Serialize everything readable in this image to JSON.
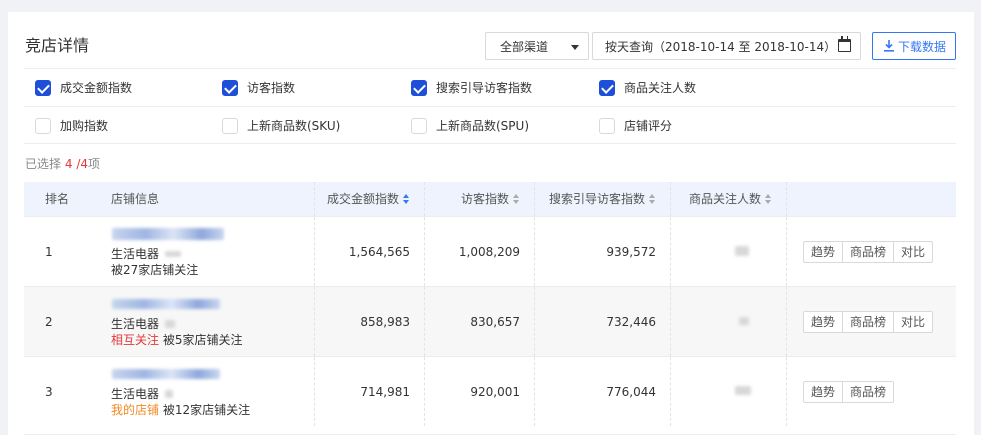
{
  "title": "竞店详情",
  "channel_select": {
    "value": "全部渠道"
  },
  "date_query": {
    "label": "按天查询（2018-10-14 至 2018-10-14）"
  },
  "download_button": {
    "label": "下载数据"
  },
  "metrics": [
    {
      "label": "成交金额指数",
      "checked": true
    },
    {
      "label": "访客指数",
      "checked": true
    },
    {
      "label": "搜索引导访客指数",
      "checked": true
    },
    {
      "label": "商品关注人数",
      "checked": true
    },
    {
      "label": "加购指数",
      "checked": false
    },
    {
      "label": "上新商品数(SKU)",
      "checked": false
    },
    {
      "label": "上新商品数(SPU)",
      "checked": false
    },
    {
      "label": "店铺评分",
      "checked": false
    }
  ],
  "selection": {
    "prefix": "已选择",
    "count": "4",
    "total": "/4",
    "suffix": "项"
  },
  "table": {
    "headers": {
      "rank": "排名",
      "shop": "店铺信息",
      "gmv": "成交金额指数",
      "visitors": "访客指数",
      "search_visitors": "搜索引导访客指数",
      "followers": "商品关注人数"
    },
    "rows": [
      {
        "rank": "1",
        "category": "生活电器",
        "tag": "",
        "followers_text": "被27家店铺关注",
        "gmv": "1,564,565",
        "visitors": "1,008,209",
        "search_visitors": "939,572",
        "actions": [
          "趋势",
          "商品榜",
          "对比"
        ]
      },
      {
        "rank": "2",
        "category": "生活电器",
        "tag": "相互关注",
        "followers_text": "被5家店铺关注",
        "gmv": "858,983",
        "visitors": "830,657",
        "search_visitors": "732,446",
        "actions": [
          "趋势",
          "商品榜",
          "对比"
        ]
      },
      {
        "rank": "3",
        "category": "生活电器",
        "tag": "我的店铺",
        "followers_text": "被12家店铺关注",
        "gmv": "714,981",
        "visitors": "920,001",
        "search_visitors": "776,044",
        "actions": [
          "趋势",
          "商品榜"
        ]
      }
    ]
  },
  "colors": {
    "primary": "#3677f5",
    "checkbox": "#1e4fd8",
    "highlight_red": "#e4393c",
    "highlight_orange": "#f08a24"
  }
}
